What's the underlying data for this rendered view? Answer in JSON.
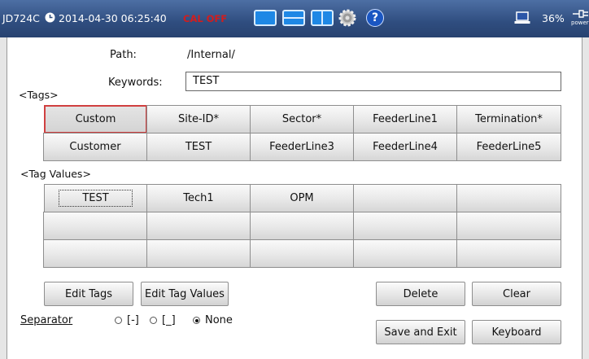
{
  "titlebar": {
    "device": "JD724C",
    "datetime": "2014-04-30 06:25:40",
    "cal_status": "CAL OFF",
    "battery": "36%",
    "power_label": "power"
  },
  "form": {
    "path_label": "Path:",
    "path_value": "/Internal/",
    "keywords_label": "Keywords:",
    "keywords_value": "TEST"
  },
  "tags": {
    "header": "<Tags>",
    "cells": [
      "Custom",
      "Site-ID*",
      "Sector*",
      "FeederLine1",
      "Termination*",
      "Customer",
      "TEST",
      "FeederLine3",
      "FeederLine4",
      "FeederLine5"
    ]
  },
  "tag_values": {
    "header": "<Tag Values>",
    "cells": [
      "TEST",
      "Tech1",
      "OPM",
      "",
      "",
      "",
      "",
      "",
      "",
      "",
      "",
      "",
      "",
      "",
      ""
    ]
  },
  "buttons": {
    "edit_tags": "Edit Tags",
    "edit_tag_values": "Edit Tag Values",
    "delete": "Delete",
    "clear": "Clear",
    "save_exit": "Save and Exit",
    "keyboard": "Keyboard"
  },
  "separator": {
    "label": "Separator",
    "options": [
      "[-]",
      "[_]",
      "None"
    ],
    "selected": "None"
  }
}
